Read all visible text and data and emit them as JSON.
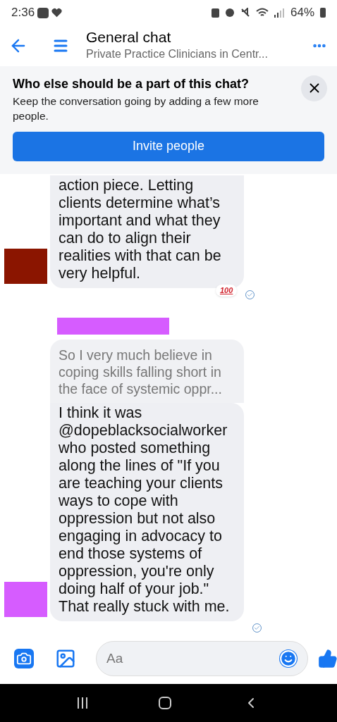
{
  "status_bar": {
    "time": "2:36",
    "battery": "64%"
  },
  "header": {
    "title": "General chat",
    "subtitle": "Private Practice Clinicians in Centr..."
  },
  "banner": {
    "title": "Who else should be a part of this chat?",
    "text": "Keep the conversation going by adding a few more people.",
    "button": "Invite people"
  },
  "messages": [
    {
      "color": "#8b1500",
      "redacted_name": false,
      "text": "action piece. Letting clients determine what’s important and what they can do to align their realities with that can be very helpful.",
      "reaction": "100",
      "seen": true
    },
    {
      "color": "#d65cff",
      "redacted_name": true,
      "reply": "So I very much believe in coping skills falling short in the face of systemic oppr...",
      "text": "I think it was @dopeblacksocialworker who posted something along the lines of \"If you are teaching your clients ways to cope with oppression but not also engaging in advocacy to end those systems of oppression, you're only doing half of your job.\" That really stuck with me.",
      "seen": true
    }
  ],
  "composer": {
    "placeholder": "Aa"
  }
}
